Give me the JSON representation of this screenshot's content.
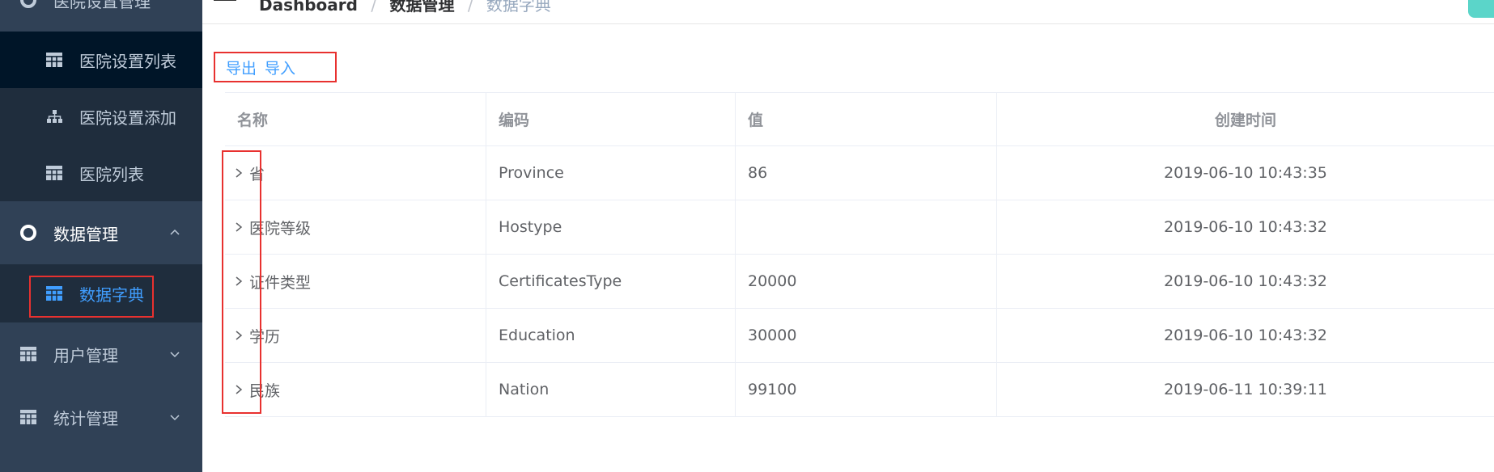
{
  "sidebar": {
    "items": [
      {
        "label": "医院设置管理",
        "level": "top",
        "icon": "circle-icon"
      },
      {
        "label": "医院设置列表",
        "level": "sub",
        "icon": "table-icon",
        "selected": true
      },
      {
        "label": "医院设置添加",
        "level": "sub",
        "icon": "tree-icon"
      },
      {
        "label": "医院列表",
        "level": "sub",
        "icon": "table-icon"
      },
      {
        "label": "数据管理",
        "level": "top",
        "icon": "circle-icon",
        "expanded": true
      },
      {
        "label": "数据字典",
        "level": "sub",
        "icon": "table-icon",
        "active": true
      },
      {
        "label": "用户管理",
        "level": "top",
        "icon": "table-icon"
      },
      {
        "label": "统计管理",
        "level": "top",
        "icon": "table-icon"
      }
    ]
  },
  "navbar": {
    "breadcrumb": [
      "Dashboard",
      "数据管理",
      "数据字典"
    ]
  },
  "toolbar": {
    "export_label": "导出",
    "import_label": "导入"
  },
  "table": {
    "columns": [
      "名称",
      "编码",
      "值",
      "创建时间"
    ],
    "rows": [
      {
        "name": "省",
        "code": "Province",
        "value": "86",
        "created": "2019-06-10 10:43:35"
      },
      {
        "name": "医院等级",
        "code": "Hostype",
        "value": "",
        "created": "2019-06-10 10:43:32"
      },
      {
        "name": "证件类型",
        "code": "CertificatesType",
        "value": "20000",
        "created": "2019-06-10 10:43:32"
      },
      {
        "name": "学历",
        "code": "Education",
        "value": "30000",
        "created": "2019-06-10 10:43:32"
      },
      {
        "name": "民族",
        "code": "Nation",
        "value": "99100",
        "created": "2019-06-11 10:39:11"
      }
    ]
  },
  "colors": {
    "sidebar_bg": "#304156",
    "submenu_bg": "#1f2d3d",
    "accent": "#409eff",
    "highlight_box": "#e8312f"
  }
}
